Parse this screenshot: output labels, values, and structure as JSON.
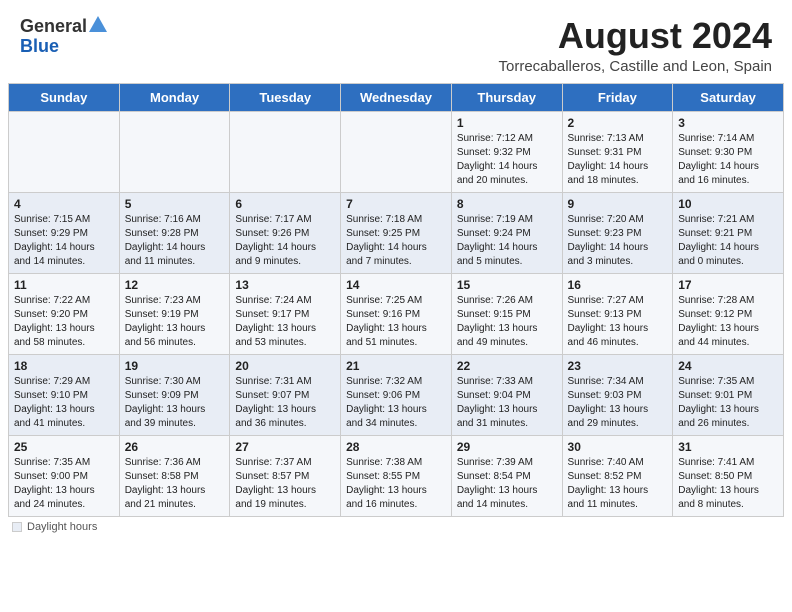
{
  "header": {
    "logo_general": "General",
    "logo_blue": "Blue",
    "main_title": "August 2024",
    "subtitle": "Torrecaballeros, Castille and Leon, Spain"
  },
  "days_of_week": [
    "Sunday",
    "Monday",
    "Tuesday",
    "Wednesday",
    "Thursday",
    "Friday",
    "Saturday"
  ],
  "weeks": [
    [
      {
        "num": "",
        "content": ""
      },
      {
        "num": "",
        "content": ""
      },
      {
        "num": "",
        "content": ""
      },
      {
        "num": "",
        "content": ""
      },
      {
        "num": "1",
        "content": "Sunrise: 7:12 AM\nSunset: 9:32 PM\nDaylight: 14 hours\nand 20 minutes."
      },
      {
        "num": "2",
        "content": "Sunrise: 7:13 AM\nSunset: 9:31 PM\nDaylight: 14 hours\nand 18 minutes."
      },
      {
        "num": "3",
        "content": "Sunrise: 7:14 AM\nSunset: 9:30 PM\nDaylight: 14 hours\nand 16 minutes."
      }
    ],
    [
      {
        "num": "4",
        "content": "Sunrise: 7:15 AM\nSunset: 9:29 PM\nDaylight: 14 hours\nand 14 minutes."
      },
      {
        "num": "5",
        "content": "Sunrise: 7:16 AM\nSunset: 9:28 PM\nDaylight: 14 hours\nand 11 minutes."
      },
      {
        "num": "6",
        "content": "Sunrise: 7:17 AM\nSunset: 9:26 PM\nDaylight: 14 hours\nand 9 minutes."
      },
      {
        "num": "7",
        "content": "Sunrise: 7:18 AM\nSunset: 9:25 PM\nDaylight: 14 hours\nand 7 minutes."
      },
      {
        "num": "8",
        "content": "Sunrise: 7:19 AM\nSunset: 9:24 PM\nDaylight: 14 hours\nand 5 minutes."
      },
      {
        "num": "9",
        "content": "Sunrise: 7:20 AM\nSunset: 9:23 PM\nDaylight: 14 hours\nand 3 minutes."
      },
      {
        "num": "10",
        "content": "Sunrise: 7:21 AM\nSunset: 9:21 PM\nDaylight: 14 hours\nand 0 minutes."
      }
    ],
    [
      {
        "num": "11",
        "content": "Sunrise: 7:22 AM\nSunset: 9:20 PM\nDaylight: 13 hours\nand 58 minutes."
      },
      {
        "num": "12",
        "content": "Sunrise: 7:23 AM\nSunset: 9:19 PM\nDaylight: 13 hours\nand 56 minutes."
      },
      {
        "num": "13",
        "content": "Sunrise: 7:24 AM\nSunset: 9:17 PM\nDaylight: 13 hours\nand 53 minutes."
      },
      {
        "num": "14",
        "content": "Sunrise: 7:25 AM\nSunset: 9:16 PM\nDaylight: 13 hours\nand 51 minutes."
      },
      {
        "num": "15",
        "content": "Sunrise: 7:26 AM\nSunset: 9:15 PM\nDaylight: 13 hours\nand 49 minutes."
      },
      {
        "num": "16",
        "content": "Sunrise: 7:27 AM\nSunset: 9:13 PM\nDaylight: 13 hours\nand 46 minutes."
      },
      {
        "num": "17",
        "content": "Sunrise: 7:28 AM\nSunset: 9:12 PM\nDaylight: 13 hours\nand 44 minutes."
      }
    ],
    [
      {
        "num": "18",
        "content": "Sunrise: 7:29 AM\nSunset: 9:10 PM\nDaylight: 13 hours\nand 41 minutes."
      },
      {
        "num": "19",
        "content": "Sunrise: 7:30 AM\nSunset: 9:09 PM\nDaylight: 13 hours\nand 39 minutes."
      },
      {
        "num": "20",
        "content": "Sunrise: 7:31 AM\nSunset: 9:07 PM\nDaylight: 13 hours\nand 36 minutes."
      },
      {
        "num": "21",
        "content": "Sunrise: 7:32 AM\nSunset: 9:06 PM\nDaylight: 13 hours\nand 34 minutes."
      },
      {
        "num": "22",
        "content": "Sunrise: 7:33 AM\nSunset: 9:04 PM\nDaylight: 13 hours\nand 31 minutes."
      },
      {
        "num": "23",
        "content": "Sunrise: 7:34 AM\nSunset: 9:03 PM\nDaylight: 13 hours\nand 29 minutes."
      },
      {
        "num": "24",
        "content": "Sunrise: 7:35 AM\nSunset: 9:01 PM\nDaylight: 13 hours\nand 26 minutes."
      }
    ],
    [
      {
        "num": "25",
        "content": "Sunrise: 7:35 AM\nSunset: 9:00 PM\nDaylight: 13 hours\nand 24 minutes."
      },
      {
        "num": "26",
        "content": "Sunrise: 7:36 AM\nSunset: 8:58 PM\nDaylight: 13 hours\nand 21 minutes."
      },
      {
        "num": "27",
        "content": "Sunrise: 7:37 AM\nSunset: 8:57 PM\nDaylight: 13 hours\nand 19 minutes."
      },
      {
        "num": "28",
        "content": "Sunrise: 7:38 AM\nSunset: 8:55 PM\nDaylight: 13 hours\nand 16 minutes."
      },
      {
        "num": "29",
        "content": "Sunrise: 7:39 AM\nSunset: 8:54 PM\nDaylight: 13 hours\nand 14 minutes."
      },
      {
        "num": "30",
        "content": "Sunrise: 7:40 AM\nSunset: 8:52 PM\nDaylight: 13 hours\nand 11 minutes."
      },
      {
        "num": "31",
        "content": "Sunrise: 7:41 AM\nSunset: 8:50 PM\nDaylight: 13 hours\nand 8 minutes."
      }
    ]
  ],
  "footer": {
    "daylight_label": "Daylight hours"
  }
}
